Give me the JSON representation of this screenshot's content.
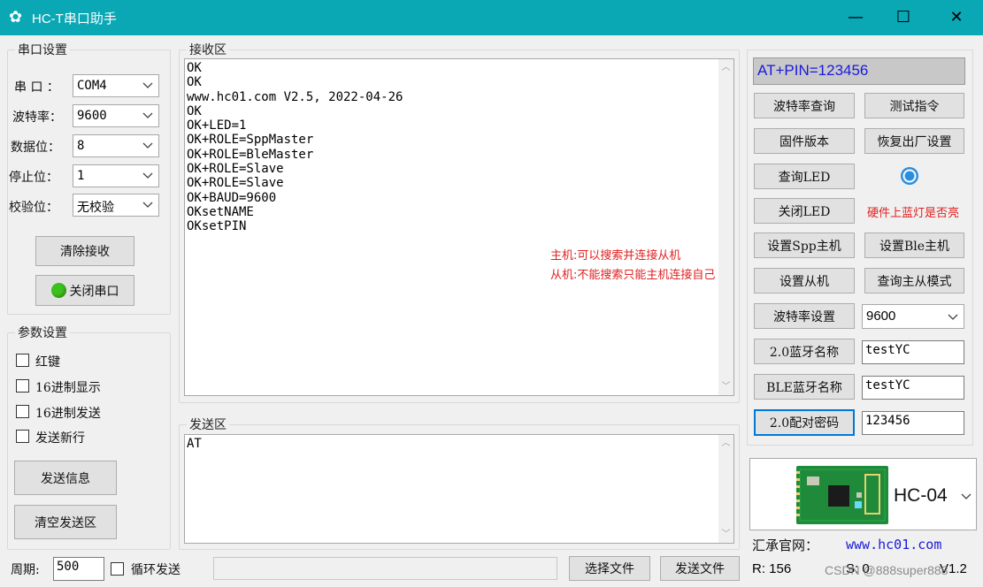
{
  "window": {
    "title": "HC-T串口助手",
    "minimize": "—",
    "maximize": "☐",
    "close": "✕"
  },
  "serial_settings": {
    "group_label": "串口设置",
    "port_label": "串  口  ：",
    "port_value": "COM4",
    "baud_label": "波特率：",
    "baud_value": "9600",
    "databits_label": "数据位：",
    "databits_value": "8",
    "stopbits_label": "停止位：",
    "stopbits_value": "1",
    "parity_label": "校验位：",
    "parity_value": "无校验",
    "clear_receive": "清除接收",
    "close_port": "关闭串口",
    "port_led_color": "#3cc21d"
  },
  "param_settings": {
    "group_label": "参数设置",
    "options": [
      "红键",
      "16进制显示",
      "16进制发送",
      "发送新行"
    ],
    "send_info": "发送信息",
    "clear_send": "清空发送区"
  },
  "receive": {
    "group_label": "接收区",
    "lines": [
      "OK",
      "OK",
      "www.hc01.com V2.5, 2022-04-26",
      "OK",
      "OK+LED=1",
      "OK+ROLE=SppMaster",
      "OK+ROLE=BleMaster",
      "OK+ROLE=Slave",
      "OK+ROLE=Slave",
      "OK+BAUD=9600",
      "OKsetNAME",
      "OKsetPIN"
    ],
    "note_master": "主机:可以搜索并连接从机",
    "note_slave": "从机:不能搜索只能主机连接自己"
  },
  "send": {
    "group_label": "发送区",
    "text": "AT"
  },
  "right_panel": {
    "command_display": "AT+PIN=123456",
    "buttons": {
      "baud_query": "波特率查询",
      "test_cmd": "测试指令",
      "firmware": "固件版本",
      "factory_reset": "恢复出厂设置",
      "query_led": "查询LED",
      "close_led": "关闭LED",
      "set_spp_master": "设置Spp主机",
      "set_ble_master": "设置Ble主机",
      "set_slave": "设置从机",
      "query_mode": "查询主从模式",
      "baud_set": "波特率设置",
      "bt_name_20": "2.0蓝牙名称",
      "ble_name": "BLE蓝牙名称",
      "pair_pin_20": "2.0配对密码"
    },
    "led_hint": "硬件上蓝灯是否亮",
    "baud_set_value": "9600",
    "bt_name_20_value": "testYC",
    "ble_name_value": "testYC",
    "pair_pin_value": "123456",
    "module_name": "HC-04",
    "website_label": "汇承官网：",
    "website_url": "www.hc01.com"
  },
  "bottom_bar": {
    "period_label": "周期:",
    "period_value": "500",
    "loop_send": "循环发送",
    "select_file": "选择文件",
    "send_file": "发送文件",
    "rx_count": "R: 156",
    "tx_count": "S: 0",
    "version": "V1.2",
    "watermark": "CSDN @888super888"
  }
}
